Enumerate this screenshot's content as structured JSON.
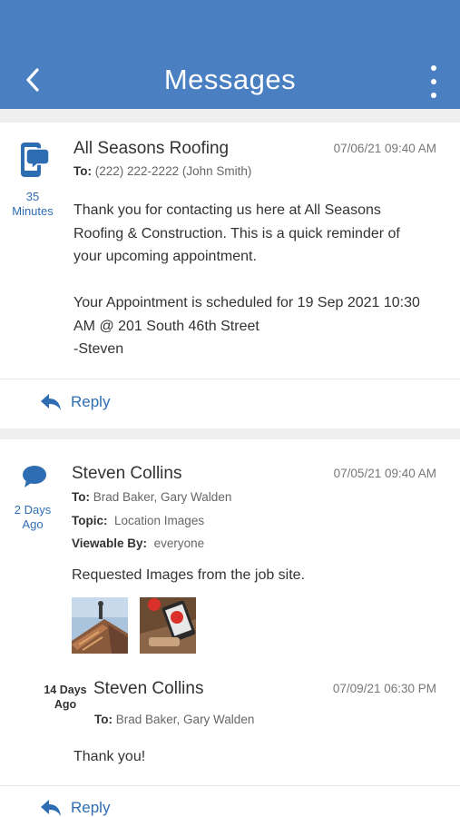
{
  "header": {
    "title": "Messages"
  },
  "messages": [
    {
      "time_value": "35",
      "time_unit": "Minutes",
      "sender": "All Seasons Roofing",
      "date": "07/06/21 09:40 AM",
      "to_label": "To:",
      "to": "(222) 222-2222 (John Smith)",
      "body_lines": [
        "Thank you for contacting us here at All Seasons",
        "Roofing & Construction. This is a quick reminder of",
        "your upcoming appointment.",
        "",
        "Your Appointment is scheduled for 19 Sep 2021 10:30",
        "AM @ 201 South 46th Street",
        "-Steven"
      ],
      "reply_label": "Reply"
    },
    {
      "time_value": "2 Days",
      "time_unit": "Ago",
      "sender": "Steven Collins",
      "date": "07/05/21 09:40 AM",
      "to_label": "To:",
      "to": "Brad Baker, Gary Walden",
      "topic_label": "Topic:",
      "topic": "Location Images",
      "viewable_label": "Viewable By:",
      "viewable": "everyone",
      "body": "Requested Images from the job site.",
      "reply_label": "Reply",
      "sub_message": {
        "time_value": "14 Days",
        "time_unit": "Ago",
        "sender": "Steven Collins",
        "date": "07/09/21 06:30 PM",
        "to_label": "To:",
        "to": "Brad Baker, Gary Walden",
        "body": "Thank you!"
      }
    }
  ],
  "colors": {
    "appbar": "#4a80c2",
    "accent": "#2f6db3",
    "background": "#efefef"
  },
  "icons": {
    "back": "chevron-left-icon",
    "more": "more-vertical-icon",
    "sms": "phone-message-icon",
    "chat": "chat-bubble-icon",
    "reply": "reply-arrow-icon"
  }
}
